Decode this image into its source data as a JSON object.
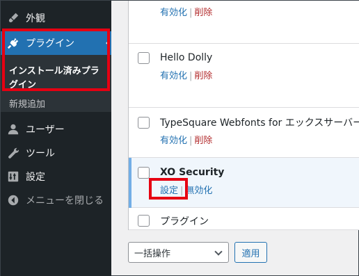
{
  "sidebar": {
    "appearance": "外観",
    "plugins": "プラグイン",
    "installed_plugins": "インストール済みプラグイン",
    "add_new": "新規追加",
    "users": "ユーザー",
    "tools": "ツール",
    "settings": "設定",
    "collapse": "メニューを閉じる"
  },
  "plugins": [
    {
      "name": "",
      "action1": "有効化",
      "action2": "削除"
    },
    {
      "name": "Hello Dolly",
      "action1": "有効化",
      "action2": "削除"
    },
    {
      "name": "TypeSquare Webfonts for エックスサーバー",
      "action1": "有効化",
      "action2": "削除"
    },
    {
      "name": "XO Security",
      "action1": "設定",
      "action2": "無効化"
    },
    {
      "name": "プラグイン"
    }
  ],
  "bulk": {
    "label": "一括操作",
    "apply": "適用"
  },
  "colors": {
    "highlight": "#e60012",
    "accent": "#2271b1",
    "sidebar": "#1d2327"
  }
}
